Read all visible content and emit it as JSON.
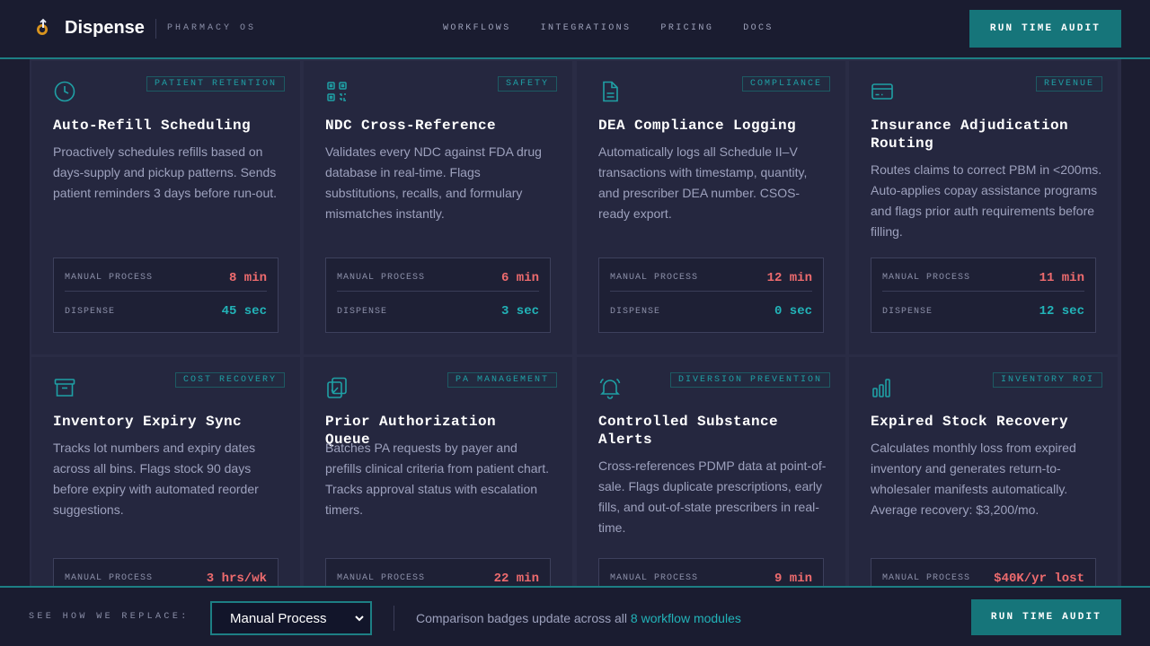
{
  "header": {
    "brand": "Dispense",
    "brand_sub": "PHARMACY OS",
    "nav": [
      "WORKFLOWS",
      "INTEGRATIONS",
      "PRICING",
      "DOCS"
    ],
    "cta": "RUN TIME AUDIT"
  },
  "labels": {
    "manual": "MANUAL PROCESS",
    "dispense": "DISPENSE"
  },
  "cards": [
    {
      "tag": "PATIENT RETENTION",
      "icon": "clock-icon",
      "title": "Auto-Refill Scheduling",
      "desc": "Proactively schedules refills based on days-supply and pickup patterns. Sends patient reminders 3 days before run-out.",
      "manual": "8 min",
      "dispense": "45 sec"
    },
    {
      "tag": "SAFETY",
      "icon": "qr-code-icon",
      "title": "NDC Cross-Reference",
      "desc": "Validates every NDC against FDA drug database in real-time. Flags substitutions, recalls, and formulary mismatches instantly.",
      "manual": "6 min",
      "dispense": "3 sec"
    },
    {
      "tag": "COMPLIANCE",
      "icon": "document-icon",
      "title": "DEA Compliance Logging",
      "desc": "Automatically logs all Schedule II–V transactions with timestamp, quantity, and prescriber DEA number. CSOS-ready export.",
      "manual": "12 min",
      "dispense": "0 sec"
    },
    {
      "tag": "REVENUE",
      "icon": "credit-card-icon",
      "title": "Insurance Adjudication Routing",
      "desc": "Routes claims to correct PBM in <200ms. Auto-applies copay assistance programs and flags prior auth requirements before filling.",
      "manual": "11 min",
      "dispense": "12 sec"
    },
    {
      "tag": "COST RECOVERY",
      "icon": "archive-box-icon",
      "title": "Inventory Expiry Sync",
      "desc": "Tracks lot numbers and expiry dates across all bins. Flags stock 90 days before expiry with automated reorder suggestions.",
      "manual": "3 hrs/wk"
    },
    {
      "tag": "PA MANAGEMENT",
      "icon": "clipboard-check-icon",
      "title": "Prior Authorization Queue",
      "desc": "Batches PA requests by payer and prefills clinical criteria from patient chart. Tracks approval status with escalation timers.",
      "manual": "22 min"
    },
    {
      "tag": "DIVERSION PREVENTION",
      "icon": "bell-icon",
      "title": "Controlled Substance Alerts",
      "desc": "Cross-references PDMP data at point-of-sale. Flags duplicate prescriptions, early fills, and out-of-state prescribers in real-time.",
      "manual": "9 min"
    },
    {
      "tag": "INVENTORY ROI",
      "icon": "bar-chart-icon",
      "title": "Expired Stock Recovery",
      "desc": "Calculates monthly loss from expired inventory and generates return-to-wholesaler manifests automatically. Average recovery: $3,200/mo.",
      "manual": "$40K/yr lost"
    }
  ],
  "footer": {
    "see_how": "SEE HOW WE REPLACE:",
    "select_value": "Manual Process",
    "note_prefix": "Comparison badges update across all ",
    "note_highlight": "8 workflow modules",
    "cta": "RUN TIME AUDIT"
  },
  "colors": {
    "accent": "#16757a",
    "accent_text": "#22b3b8",
    "manual_value": "#ee6b6e",
    "background": "#1c1d31",
    "card": "#25273f"
  }
}
